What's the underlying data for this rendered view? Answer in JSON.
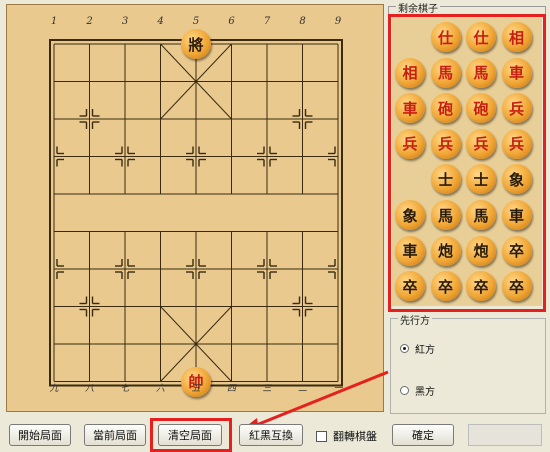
{
  "board": {
    "top_files": [
      "1",
      "2",
      "3",
      "4",
      "5",
      "6",
      "7",
      "8",
      "9"
    ],
    "bottom_files": [
      "九",
      "八",
      "七",
      "六",
      "五",
      "四",
      "三",
      "二",
      "一"
    ],
    "pieces": [
      {
        "name": "black-general",
        "char": "將",
        "side": "black",
        "file": 5,
        "rank": 0
      },
      {
        "name": "red-marshal",
        "char": "帥",
        "side": "red",
        "file": 5,
        "rank": 9
      }
    ]
  },
  "palette": {
    "title": "剩余棋子",
    "pieces": [
      {
        "char": "仕",
        "side": "red"
      },
      {
        "char": "仕",
        "side": "red"
      },
      {
        "char": "相",
        "side": "red"
      },
      {
        "char": "相",
        "side": "red"
      },
      {
        "char": "馬",
        "side": "red"
      },
      {
        "char": "馬",
        "side": "red"
      },
      {
        "char": "車",
        "side": "red"
      },
      {
        "char": "車",
        "side": "red"
      },
      {
        "char": "砲",
        "side": "red"
      },
      {
        "char": "砲",
        "side": "red"
      },
      {
        "char": "兵",
        "side": "red"
      },
      {
        "char": "兵",
        "side": "red"
      },
      {
        "char": "兵",
        "side": "red"
      },
      {
        "char": "兵",
        "side": "red"
      },
      {
        "char": "兵",
        "side": "red"
      },
      {
        "char": "士",
        "side": "black"
      },
      {
        "char": "士",
        "side": "black"
      },
      {
        "char": "象",
        "side": "black"
      },
      {
        "char": "象",
        "side": "black"
      },
      {
        "char": "馬",
        "side": "black"
      },
      {
        "char": "馬",
        "side": "black"
      },
      {
        "char": "車",
        "side": "black"
      },
      {
        "char": "車",
        "side": "black"
      },
      {
        "char": "炮",
        "side": "black"
      },
      {
        "char": "炮",
        "side": "black"
      },
      {
        "char": "卒",
        "side": "black"
      },
      {
        "char": "卒",
        "side": "black"
      },
      {
        "char": "卒",
        "side": "black"
      },
      {
        "char": "卒",
        "side": "black"
      },
      {
        "char": "卒",
        "side": "black"
      }
    ]
  },
  "first_move": {
    "title": "先行方",
    "options": [
      {
        "label": "紅方",
        "selected": true
      },
      {
        "label": "黑方",
        "selected": false
      }
    ]
  },
  "toolbar": {
    "start": "開始局面",
    "current": "當前局面",
    "clear": "清空局面",
    "swap": "紅黑互換",
    "flip": "翻轉棋盤",
    "ok": "確定"
  },
  "colors": {
    "highlight": "#e5201e",
    "board": "#e9c98e",
    "red_piece_text": "#c81e10",
    "black_piece_text": "#2a1a08"
  }
}
